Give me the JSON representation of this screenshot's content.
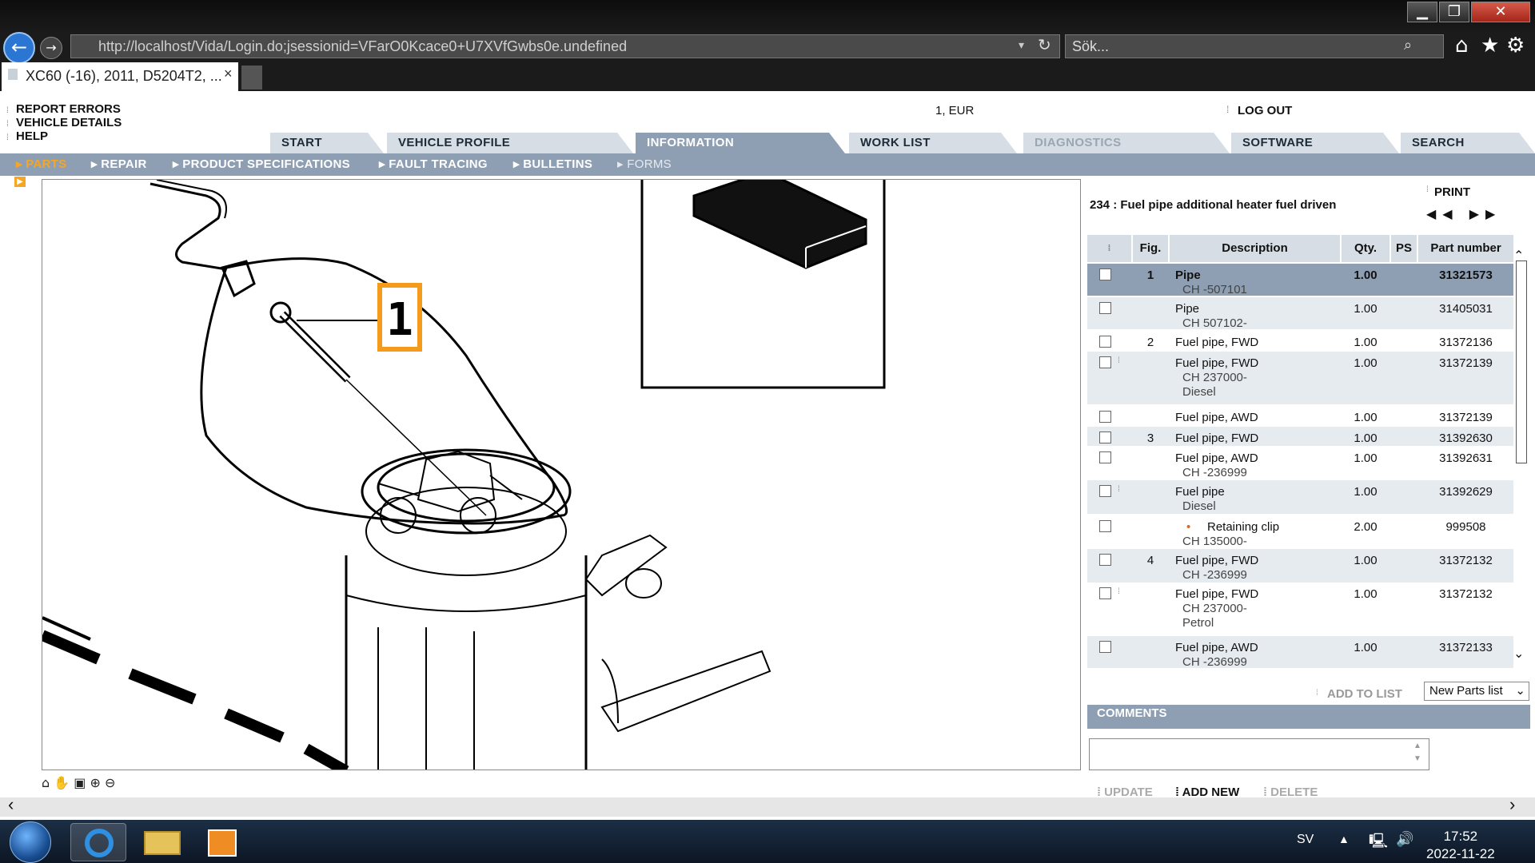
{
  "browser": {
    "url": "http://localhost/Vida/Login.do;jsessionid=VFarO0Kcace0+U7XVfGwbs0e.undefined",
    "search_placeholder": "Sök...",
    "tab_title": "XC60 (-16), 2011, D5204T2, ...",
    "tab_close": "×"
  },
  "header": {
    "links": [
      "REPORT ERRORS",
      "VEHICLE DETAILS",
      "HELP"
    ],
    "currency": "1, EUR",
    "logout": "LOG OUT"
  },
  "main_tabs": [
    {
      "label": "START",
      "state": "normal"
    },
    {
      "label": "VEHICLE PROFILE",
      "state": "normal"
    },
    {
      "label": "INFORMATION",
      "state": "active"
    },
    {
      "label": "WORK LIST",
      "state": "normal"
    },
    {
      "label": "DIAGNOSTICS",
      "state": "disabled"
    },
    {
      "label": "SOFTWARE",
      "state": "normal"
    },
    {
      "label": "SEARCH",
      "state": "normal"
    }
  ],
  "sub_tabs": [
    "PARTS",
    "REPAIR",
    "PRODUCT SPECIFICATIONS",
    "FAULT TRACING",
    "BULLETINS",
    "FORMS"
  ],
  "figure": {
    "callout": "1"
  },
  "parts_panel": {
    "print": "PRINT",
    "title": "234 : Fuel pipe additional heater fuel driven",
    "columns": {
      "fig": "Fig.",
      "description": "Description",
      "qty": "Qty.",
      "ps": "PS",
      "part_number": "Part number"
    },
    "rows": [
      {
        "fig": "1",
        "desc": "Pipe",
        "sub": [
          "CH -507101"
        ],
        "qty": "1.00",
        "part": "31321573"
      },
      {
        "fig": "",
        "desc": "Pipe",
        "sub": [
          "CH 507102-"
        ],
        "qty": "1.00",
        "part": "31405031"
      },
      {
        "fig": "2",
        "desc": "Fuel pipe, FWD",
        "sub": [],
        "qty": "1.00",
        "part": "31372136"
      },
      {
        "fig": "",
        "desc": "Fuel pipe, FWD",
        "sub": [
          "CH 237000-",
          "Diesel"
        ],
        "qty": "1.00",
        "part": "31372139"
      },
      {
        "fig": "",
        "desc": "Fuel pipe, AWD",
        "sub": [],
        "qty": "1.00",
        "part": "31372139"
      },
      {
        "fig": "3",
        "desc": "Fuel pipe, FWD",
        "sub": [],
        "qty": "1.00",
        "part": "31392630"
      },
      {
        "fig": "",
        "desc": "Fuel pipe, AWD",
        "sub": [
          "CH -236999"
        ],
        "qty": "1.00",
        "part": "31392631"
      },
      {
        "fig": "",
        "desc": "Fuel pipe",
        "sub": [
          "Diesel"
        ],
        "qty": "1.00",
        "part": "31392629"
      },
      {
        "fig": "",
        "desc": "Retaining clip",
        "sub": [
          "CH 135000-"
        ],
        "qty": "2.00",
        "part": "999508"
      },
      {
        "fig": "4",
        "desc": "Fuel pipe, FWD",
        "sub": [
          "CH -236999"
        ],
        "qty": "1.00",
        "part": "31372132"
      },
      {
        "fig": "",
        "desc": "Fuel pipe, FWD",
        "sub": [
          "CH 237000-",
          "Petrol"
        ],
        "qty": "1.00",
        "part": "31372132"
      },
      {
        "fig": "",
        "desc": "Fuel pipe, AWD",
        "sub": [
          "CH -236999"
        ],
        "qty": "1.00",
        "part": "31372133"
      }
    ],
    "add_to_list": "ADD TO LIST",
    "parts_list_select": "New Parts list",
    "comments_label": "COMMENTS",
    "comment_buttons": [
      "UPDATE",
      "ADD NEW",
      "DELETE"
    ]
  },
  "taskbar": {
    "lang": "SV",
    "time": "17:52",
    "date": "2022-11-22"
  }
}
